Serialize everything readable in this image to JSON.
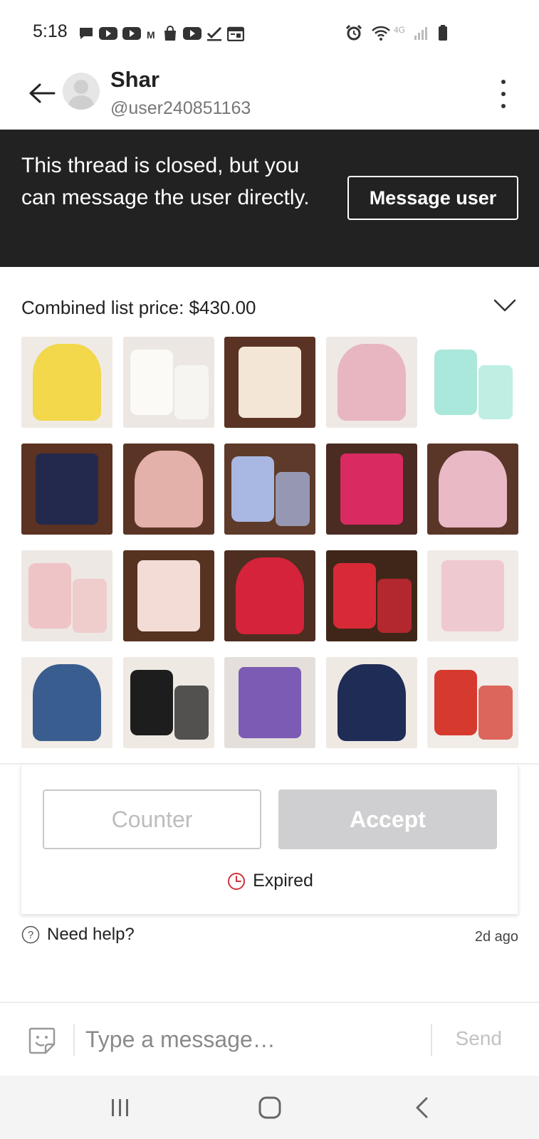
{
  "status_bar": {
    "time": "5:18",
    "left_icons": [
      "chat-bubble-icon",
      "youtube-icon",
      "youtube-icon",
      "gmail-icon",
      "shopping-bag-icon",
      "youtube-icon",
      "checkmark-icon",
      "calendar-icon"
    ],
    "right_icons": [
      "alarm-icon",
      "wifi-icon",
      "4g-icon",
      "signal-icon",
      "battery-icon"
    ],
    "network_label": "4G"
  },
  "header": {
    "name": "Shar",
    "handle": "@user240851163"
  },
  "banner": {
    "text": "This thread is closed, but you can message the user directly.",
    "button_label": "Message user"
  },
  "listing": {
    "combined_price_label": "Combined list price: $430.00",
    "thumbnails": [
      {
        "bg": "#efeae4",
        "item": "#f2d84a",
        "desc": "yellow dress"
      },
      {
        "bg": "#ece7e2",
        "item": "#fbfaf6",
        "desc": "white top and floral bloomers"
      },
      {
        "bg": "#5a3324",
        "item": "#f3e6d6",
        "desc": "floral outfit set"
      },
      {
        "bg": "#efe9e5",
        "item": "#e7b6c1",
        "desc": "pink hooded jacket"
      },
      {
        "bg": "#ffffff",
        "item": "#a9e8da",
        "desc": "mint dress"
      },
      {
        "bg": "#5c3222",
        "item": "#23294d",
        "desc": "top and navy bloomers"
      },
      {
        "bg": "#5a3525",
        "item": "#e3b0aa",
        "desc": "pink jacket and pants"
      },
      {
        "bg": "#5e3a2a",
        "item": "#a9b8e2",
        "desc": "light blue pants"
      },
      {
        "bg": "#4a2c22",
        "item": "#d92a62",
        "desc": "pink shoes"
      },
      {
        "bg": "#5a3628",
        "item": "#e9b9c6",
        "desc": "jeans and pink set"
      },
      {
        "bg": "#ede8e3",
        "item": "#efc4c6",
        "desc": "pink romper"
      },
      {
        "bg": "#563221",
        "item": "#f3dcd5",
        "desc": "floral dress set"
      },
      {
        "bg": "#4d2e21",
        "item": "#d4233a",
        "desc": "reindeer sweater and red pants"
      },
      {
        "bg": "#402618",
        "item": "#d82a36",
        "desc": "top and red shorts"
      },
      {
        "bg": "#f0ebe6",
        "item": "#efc9d0",
        "desc": "pink outfit set"
      },
      {
        "bg": "#f1ece7",
        "item": "#3a5d8f",
        "desc": "denim dress and pink bodysuit"
      },
      {
        "bg": "#efe9e3",
        "item": "#1d1d1d",
        "desc": "bee top and black pants"
      },
      {
        "bg": "#e4dfdb",
        "item": "#7b5bb3",
        "desc": "purple dress"
      },
      {
        "bg": "#efe9e3",
        "item": "#1f2c55",
        "desc": "bee top and jeans"
      },
      {
        "bg": "#f1ece7",
        "item": "#d6392e",
        "desc": "red bodysuit and skirt"
      }
    ]
  },
  "offer": {
    "counter_label": "Counter",
    "accept_label": "Accept",
    "status_label": "Expired",
    "status_color": "#d0323b"
  },
  "help": {
    "label": "Need help?",
    "timestamp": "2d ago"
  },
  "composer": {
    "placeholder": "Type a message…",
    "value": "",
    "send_label": "Send"
  },
  "colors": {
    "banner_bg": "#222222",
    "accept_disabled": "#cfcfd1",
    "expired_red": "#d0323b"
  }
}
